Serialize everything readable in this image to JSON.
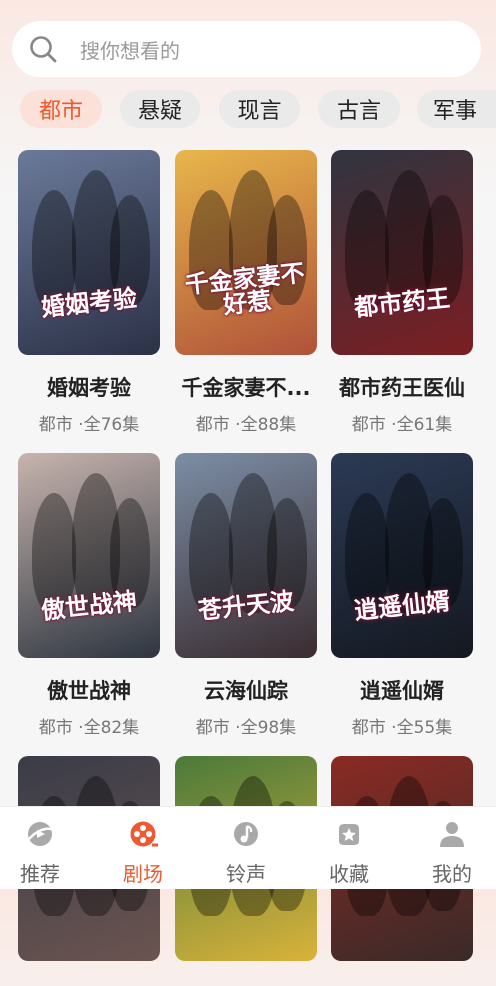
{
  "search": {
    "placeholder": "搜你想看的"
  },
  "categories": [
    {
      "label": "都市",
      "active": true
    },
    {
      "label": "悬疑",
      "active": false
    },
    {
      "label": "现言",
      "active": false
    },
    {
      "label": "古言",
      "active": false
    },
    {
      "label": "军事",
      "active": false
    }
  ],
  "dramas": [
    {
      "title": "婚姻考验",
      "meta": "都市 ·全76集",
      "poster_text": "婚姻考验",
      "colors": [
        "#6b7a9a",
        "#2b3147"
      ]
    },
    {
      "title": "千金家妻不...",
      "meta": "都市 ·全88集",
      "poster_text": "千金家妻不好惹",
      "colors": [
        "#e8b64a",
        "#b0523a"
      ]
    },
    {
      "title": "都市药王医仙",
      "meta": "都市 ·全61集",
      "poster_text": "都市药王",
      "colors": [
        "#2f3540",
        "#7c1e22"
      ]
    },
    {
      "title": "傲世战神",
      "meta": "都市 ·全82集",
      "poster_text": "傲世战神",
      "colors": [
        "#c7b4ae",
        "#2d3540"
      ]
    },
    {
      "title": "云海仙踪",
      "meta": "都市 ·全98集",
      "poster_text": "苍升天波",
      "colors": [
        "#7c8ea6",
        "#3a2c30"
      ]
    },
    {
      "title": "逍遥仙婿",
      "meta": "都市 ·全55集",
      "poster_text": "逍遥仙婿",
      "colors": [
        "#2b3a55",
        "#141820"
      ]
    },
    {
      "title": "",
      "meta": "",
      "poster_text": "",
      "colors": [
        "#3a3c48",
        "#6b5450"
      ]
    },
    {
      "title": "",
      "meta": "",
      "poster_text": "",
      "colors": [
        "#4a7a3a",
        "#d9b23a"
      ]
    },
    {
      "title": "",
      "meta": "",
      "poster_text": "",
      "colors": [
        "#8a2a24",
        "#3a2a28"
      ]
    }
  ],
  "nav": [
    {
      "label": "推荐",
      "icon": "recommend-icon",
      "active": false
    },
    {
      "label": "剧场",
      "icon": "theater-icon",
      "active": true
    },
    {
      "label": "铃声",
      "icon": "ringtone-icon",
      "active": false
    },
    {
      "label": "收藏",
      "icon": "favorites-icon",
      "active": false
    },
    {
      "label": "我的",
      "icon": "profile-icon",
      "active": false
    }
  ],
  "colors": {
    "accent": "#f0592f",
    "accent_bg": "#fbe1d7",
    "muted": "#777777"
  }
}
